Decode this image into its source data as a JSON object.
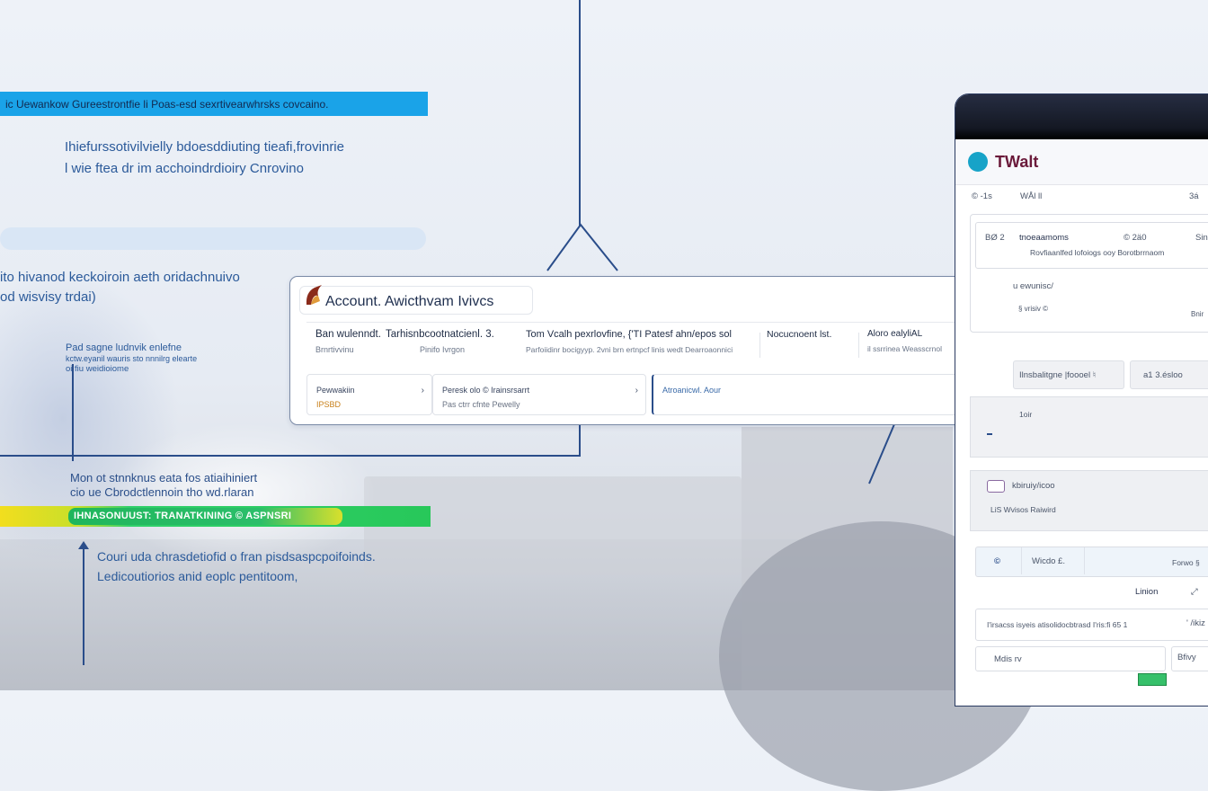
{
  "left_panel": {
    "banner": "ic Uewankow   Gureestrontfie li Poas-esd sexrtivearwhrsks covcaino.",
    "heading_lines": [
      "Ihiefurssotivilvielly bdoesddiuting tieafi,frovinrie",
      "l wie ftea dr  im acchoindrdioiry Cnrovino"
    ],
    "mid_lines": [
      "ito hivanod keckoiroin aeth oridachnuivo",
      "od wisvisy trdai)"
    ],
    "small_lines": [
      "Pad  sagne ludnvik enlefne",
      "kctw.eyanil wauris sto nnnilrg elearte",
      "oi  fiu weidioiome"
    ],
    "lower_lines": [
      "Mon ot stnnknus eata fos atiaihiniert",
      "cio ue Cbrodctlennoin tho wd.rlaran"
    ],
    "green_banner": "IHNASONUUST: TRANATKINING  © ASPNSRI",
    "bottom_lines": [
      "Couri uda chrasdetiofid o fran pisdsaspcpoifoinds.",
      "Ledicoutiorios anid eoplc pentitoom,"
    ]
  },
  "account_card": {
    "title": "Account. Awicthvam Ivivcs",
    "columns": [
      {
        "heading": "Ban wulenndt.",
        "sub": "Brnrtivvinu"
      },
      {
        "heading": "Tarhisnbcootnatcienl. 3.",
        "sub": "Pinifo  Ivrgon"
      },
      {
        "heading": "Tom Vcalh pexrlovfine, {'TI Patesf ahn/epos sol",
        "sub": "Parfoiidinr bocigyyp. 2vni  brn ertnpcf linis wedt Dearroaonnici"
      },
      {
        "heading": "Nocucnoent lst.",
        "sub": ""
      },
      {
        "heading": "Aloro ealyliAL",
        "sub": "il  ssrrinea Weasscrnol"
      }
    ],
    "tiles": [
      {
        "line1": "Pewwakiin",
        "line2": "IPSBD"
      },
      {
        "line1": "Peresk olo  © Irainsrsarrt",
        "line2": "Pas ctrr cfnte  Pewelly"
      },
      {
        "line1": "Atroanicwl. Aour",
        "line2": ""
      }
    ]
  },
  "app_window": {
    "brand": "TWalt",
    "toolbar": [
      "©  -1s",
      "WÅl  ll",
      "3á"
    ],
    "row1": {
      "id": "BØ  2",
      "name": "tnoeaamoms",
      "tag": "© 2ä0",
      "extra": "Sin",
      "desc": "Rovfiaanlfed lofoiogs ooy Borotbrrnaom"
    },
    "row2": {
      "label": "u ewunisc/",
      "sub": "§ vrisiv  ©",
      "extra": "Bnir"
    },
    "buttons": [
      "Ilnsbalitgne |foooel  ♮",
      "a1 3.ésloo"
    ],
    "grey_label": "1oir",
    "row3": {
      "label": "kbiruiy/icoo",
      "sub": "LiS   Wvisos   Raiwird"
    },
    "tabs": [
      "©",
      "Wicdo £.",
      "Forwo §"
    ],
    "section": "Linion",
    "field": "I'irsacss isyeis atisolidocbtrasd I'ris:fi 65 1",
    "field_tail": "' /ikiz",
    "menu_item": "Mdis rv",
    "side_label": "Bfivy"
  }
}
